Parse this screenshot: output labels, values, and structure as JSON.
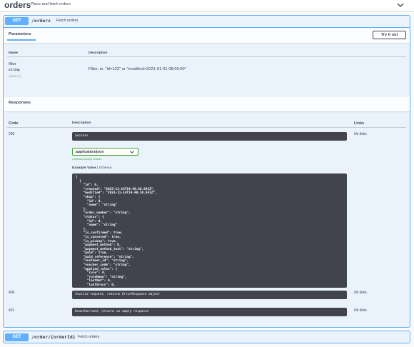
{
  "tag": {
    "title": "orders",
    "description": "Place and fetch orders"
  },
  "operations": [
    {
      "method": "GET",
      "path": "/orders",
      "summary": "Fetch orders"
    },
    {
      "method": "GET",
      "path": "/order/{orderId}",
      "summary": "Fetch orders"
    }
  ],
  "parameters": {
    "tab_label": "Parameters",
    "try_button": "Try it out",
    "columns": {
      "name": "Name",
      "description": "Description"
    },
    "items": [
      {
        "name": "filter",
        "type": "string",
        "in": "(query)",
        "description": "Filter, ie. \"id=123\" or \"modified>2021-01-01 08:00:00\""
      }
    ]
  },
  "responses": {
    "title": "Responses",
    "columns": {
      "code": "Code",
      "description": "Description",
      "links": "Links"
    },
    "media_type": "application/json",
    "accept_note": "Controls Accept header.",
    "example_label": "Example Value",
    "schema_label": "Schema",
    "items": [
      {
        "code": "200",
        "description": "Success",
        "links": "No links"
      },
      {
        "code": "400",
        "description": "Invalid request, returns ErrorResponse object",
        "links": "No links"
      },
      {
        "code": "401",
        "description": "Unauthorized, returns an empty response",
        "links": "No links"
      }
    ],
    "example_json": "[\n  {\n    \"id\": 0,\n    \"created\": \"2023-11-14T14:40:36.641Z\",\n    \"modified\": \"2023-11-14T14:40:36.641Z\",\n    \"shop\": {\n      \"id\": 0,\n      \"name\": \"string\"\n    },\n    \"order_number\": \"string\",\n    \"status\": {\n      \"id\": 0,\n      \"name\": \"string\"\n    },\n    \"is_confirmed\": true,\n    \"is_canceled\": true,\n    \"is_pickup\": true,\n    \"payment_method\": 0,\n    \"payment_method_text\": \"string\",\n    \"paid\": true,\n    \"paid_reference\": \"string\",\n    \"customer_id\": \"string\",\n    \"voucher_code\": \"string\",\n    \"applied_rules\": {\n      \"rule\": 0,\n      \"ruleName\": \"string\",\n      \"lastNet\": 0,\n      \"lastGross\": 0,"
  },
  "colors": {
    "get_method": "#61affe",
    "success_green": "#41a32c",
    "code_bg": "#41444e"
  },
  "icons": {
    "collapse": "chevron-down-icon",
    "select": "chevron-down-icon"
  }
}
